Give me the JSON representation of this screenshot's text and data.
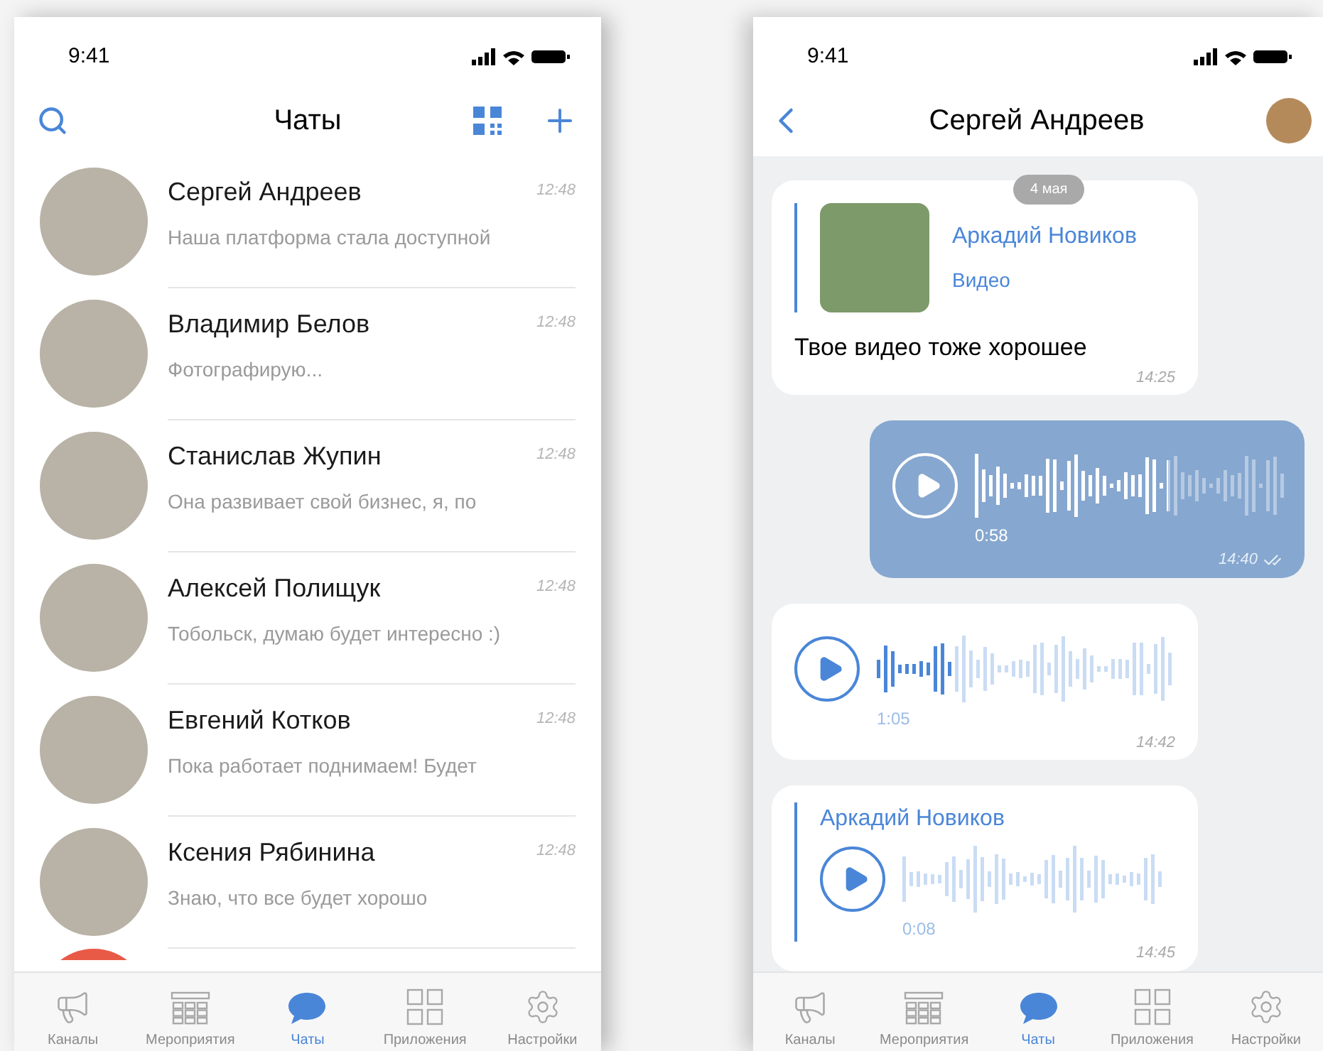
{
  "chat_list": {
    "status_time": "9:41",
    "title": "Чаты",
    "chats": [
      {
        "name": "Сергей Андреев",
        "preview": "Наша платформа стала доступной",
        "time": "12:48"
      },
      {
        "name": "Владимир Белов",
        "preview": "Фотографирую...",
        "time": "12:48"
      },
      {
        "name": "Станислав Жупин",
        "preview": "Она развивает свой бизнес, я, по",
        "time": "12:48"
      },
      {
        "name": "Алексей Полищук",
        "preview": "Тобольск, думаю будет интересно :)",
        "time": "12:48"
      },
      {
        "name": "Евгений Котков",
        "preview": "Пока работает поднимаем! Будет",
        "time": "12:48"
      },
      {
        "name": "Ксения Рябинина",
        "preview": "Знаю, что все будет хорошо",
        "time": "12:48"
      }
    ],
    "tabs": [
      {
        "label": "Каналы",
        "selected": false
      },
      {
        "label": "Мероприятия",
        "selected": false
      },
      {
        "label": "Чаты",
        "selected": true
      },
      {
        "label": "Приложения",
        "selected": false
      },
      {
        "label": "Настройки",
        "selected": false
      }
    ]
  },
  "conversation": {
    "status_time": "9:41",
    "contact_name": "Сергей Андреев",
    "date_badge": "4 мая",
    "messages": [
      {
        "kind": "forward",
        "outgoing": false,
        "author": "Аркадий Новиков",
        "media_label": "Видео",
        "text": "Твое видео тоже хорошее",
        "time": "14:25"
      },
      {
        "kind": "voice",
        "outgoing": true,
        "duration": "0:58",
        "time": "14:40",
        "level": 0.62,
        "read": true
      },
      {
        "kind": "voice",
        "outgoing": false,
        "duration": "1:05",
        "time": "14:42",
        "level": 0.25
      },
      {
        "kind": "forwarded_voice",
        "outgoing": false,
        "author": "Аркадий Новиков",
        "duration": "0:08",
        "time": "14:45"
      }
    ],
    "tabs": [
      {
        "label": "Каналы",
        "selected": false
      },
      {
        "label": "Мероприятия",
        "selected": false
      },
      {
        "label": "Чаты",
        "selected": true
      },
      {
        "label": "Приложения",
        "selected": false
      },
      {
        "label": "Настройки",
        "selected": false
      }
    ]
  }
}
